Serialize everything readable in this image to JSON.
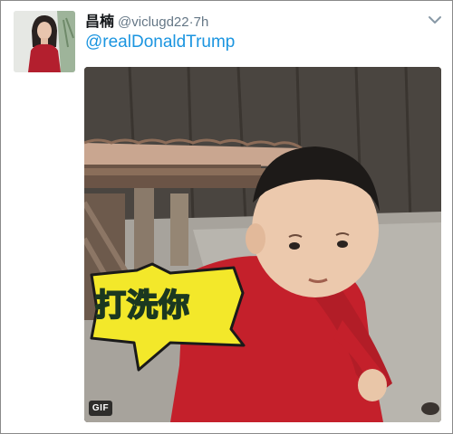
{
  "tweet": {
    "display_name": "昌楠",
    "handle": "@viclugd22",
    "separator": "·",
    "time": "7h",
    "mention": "@realDonaldTrump"
  },
  "media": {
    "speech_text": "打洗你",
    "badge": "GIF"
  },
  "icons": {
    "caret": "chevron-down-icon"
  },
  "colors": {
    "link": "#1b95e0",
    "muted": "#657786",
    "name": "#14171a",
    "speech_bubble": "#f3e82a",
    "speech_text": "#3cc95a"
  }
}
